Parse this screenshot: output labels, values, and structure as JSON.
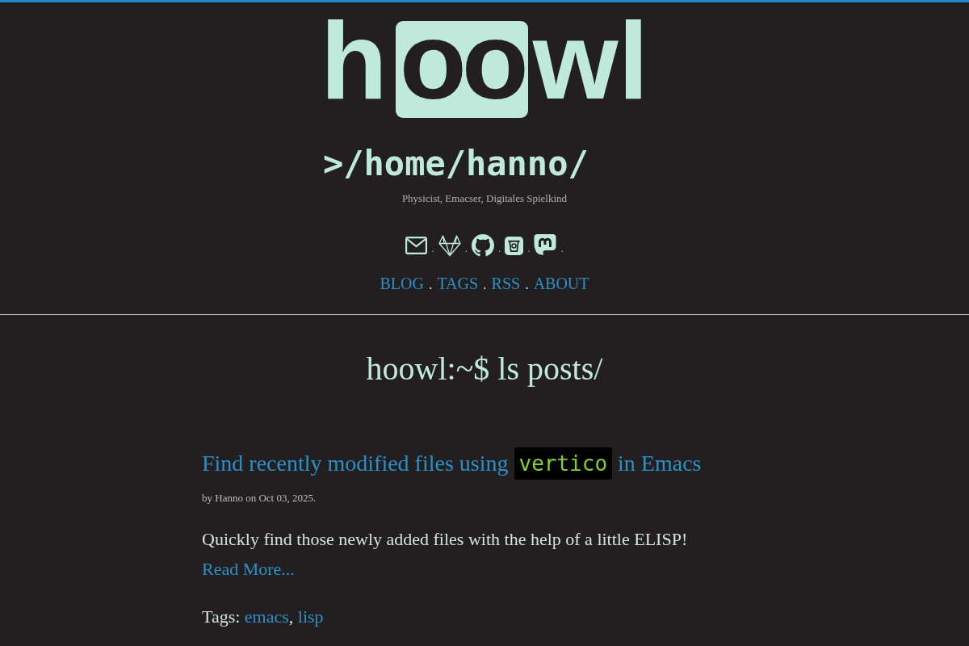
{
  "logo": {
    "before": "h",
    "boxed": "oo",
    "after": "wl"
  },
  "site_title": ">/home/hanno/",
  "tagline": "Physicist, Emacser, Digitales Spielkind",
  "social_links": [
    {
      "kind": "mail",
      "separator": "."
    },
    {
      "kind": "gitlab",
      "separator": "."
    },
    {
      "kind": "github",
      "separator": "."
    },
    {
      "kind": "cup",
      "separator": "."
    },
    {
      "kind": "mastodon",
      "separator": "."
    }
  ],
  "nav": [
    {
      "label": "BLOG",
      "separator": "."
    },
    {
      "label": "TAGS",
      "separator": "."
    },
    {
      "label": "RSS",
      "separator": "."
    },
    {
      "label": "ABOUT"
    }
  ],
  "page_heading": "hoowl:~$ ls posts/",
  "posts": [
    {
      "title": [
        {
          "kind": "text",
          "text": "Find recently modified files using"
        },
        {
          "kind": "code",
          "text": "vertico"
        },
        {
          "kind": "text",
          "text": "in Emacs"
        }
      ],
      "meta": "by Hanno on Oct 03, 2025.",
      "summary": "Quickly find those newly added files with the help of a little ELISP!",
      "read_more": "Read More...",
      "tags_label": "Tags:",
      "tags": [
        {
          "label": "emacs",
          "separator": ","
        },
        {
          "label": "lisp"
        }
      ]
    }
  ]
}
